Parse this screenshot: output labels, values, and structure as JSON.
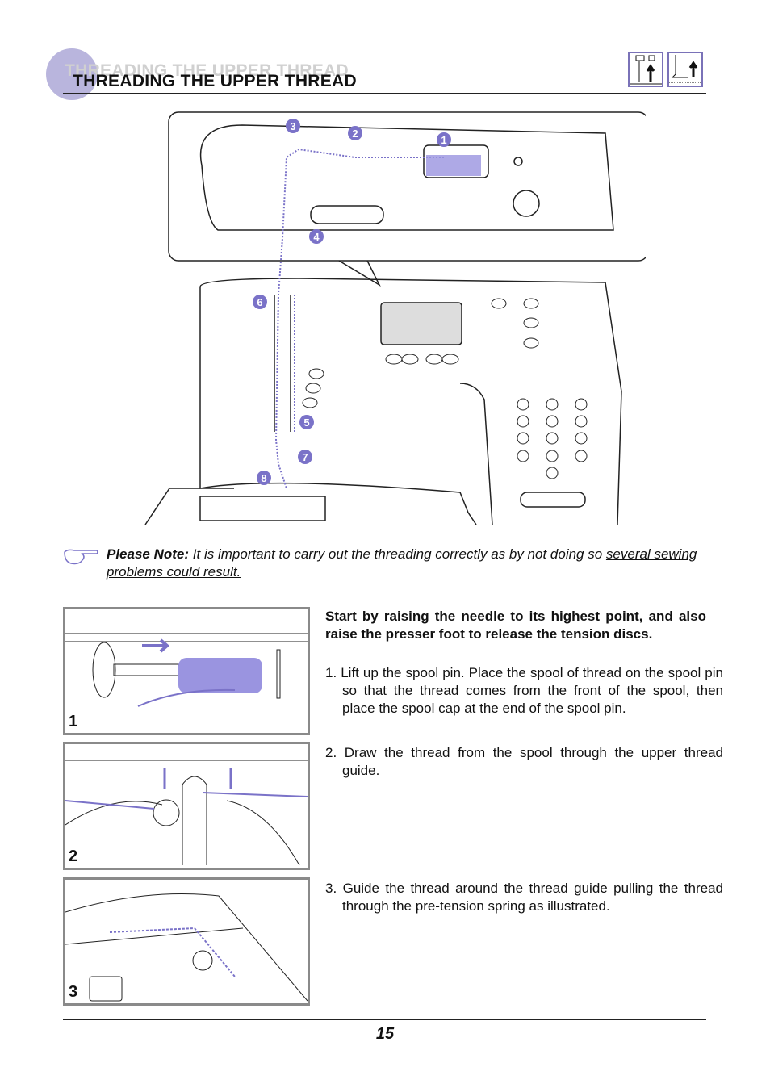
{
  "header": {
    "title": "THREADING THE UPPER THREAD",
    "ghost_title": "THREADING THE UPPER THREAD",
    "icons": [
      "needle-up-icon",
      "presser-foot-up-icon"
    ]
  },
  "illustration": {
    "callouts": [
      "1",
      "2",
      "3",
      "4",
      "5",
      "6",
      "7",
      "8"
    ],
    "accent": "#7a72c8"
  },
  "note": {
    "icon": "pointing-hand-icon",
    "label": "Please Note:",
    "text": " It is important to carry out the threading correctly as by not doing so ",
    "underlined": "several sewing problems could result."
  },
  "steps": {
    "intro": "Start by raising the needle to its highest point, and also raise the presser foot to release the tension discs.",
    "items": [
      "1. Lift up the spool pin. Place the spool of thread on the spool pin so that the thread comes from the front of the spool, then place the spool cap at the end of the spool pin.",
      "2. Draw the thread from the spool through the upper thread guide.",
      "3. Guide the thread around the thread guide pulling the thread through the pre-tension spring as illustrated."
    ],
    "panels": [
      "1",
      "2",
      "3"
    ]
  },
  "footer": {
    "page_number": "15"
  }
}
